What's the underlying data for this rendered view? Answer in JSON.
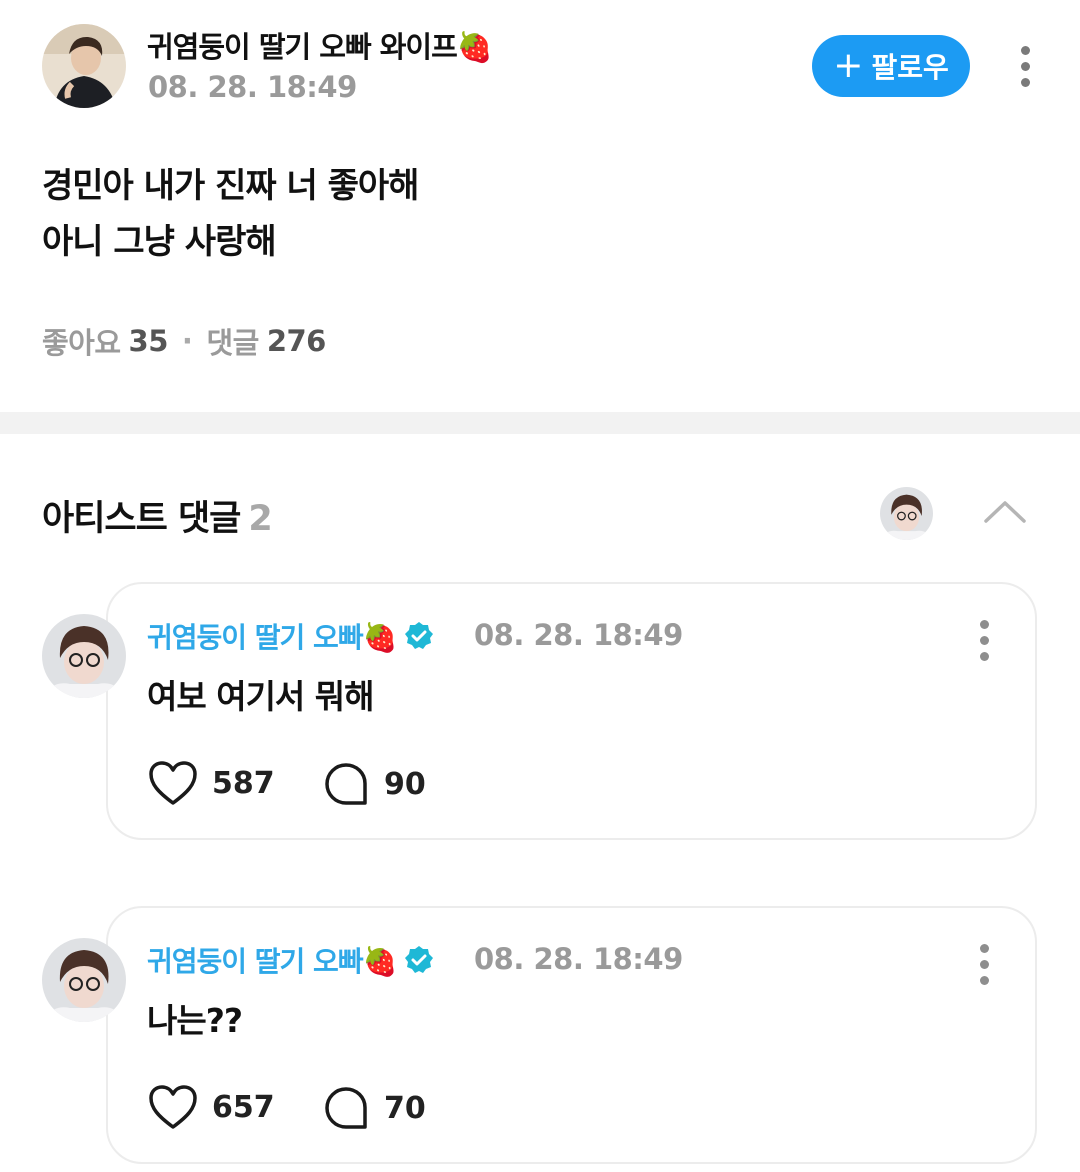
{
  "post": {
    "author": "귀염둥이 딸기 오빠 와이프🍓",
    "timestamp": "08. 28. 18:49",
    "follow_label": "팔로우",
    "follow_plus": "+",
    "body": "경민아 내가 진짜 너 좋아해\n아니 그냥 사랑해",
    "likes_label": "좋아요",
    "likes_count": "35",
    "separator": "·",
    "comments_label": "댓글",
    "comments_count": "276"
  },
  "artist_comments": {
    "title": "아티스트 댓글",
    "count": "2",
    "items": [
      {
        "author": "귀염둥이 딸기 오빠🍓",
        "timestamp": "08. 28. 18:49",
        "text": "여보 여기서 뭐해",
        "likes": "587",
        "replies": "90"
      },
      {
        "author": "귀염둥이 딸기 오빠🍓",
        "timestamp": "08. 28. 18:49",
        "text": "나는??",
        "likes": "657",
        "replies": "70"
      }
    ]
  },
  "icons": {
    "follow": "plus-icon",
    "more": "more-vertical-icon",
    "collapse": "chevron-up-icon",
    "like": "heart-icon",
    "reply": "speech-bubble-icon",
    "verified": "verified-badge-icon"
  },
  "colors": {
    "accent": "#1c9bf3",
    "artist_name": "#2fa8e8",
    "verified": "#1fb8d6",
    "muted_text": "#9a9a9a",
    "divider": "#f2f2f2"
  }
}
